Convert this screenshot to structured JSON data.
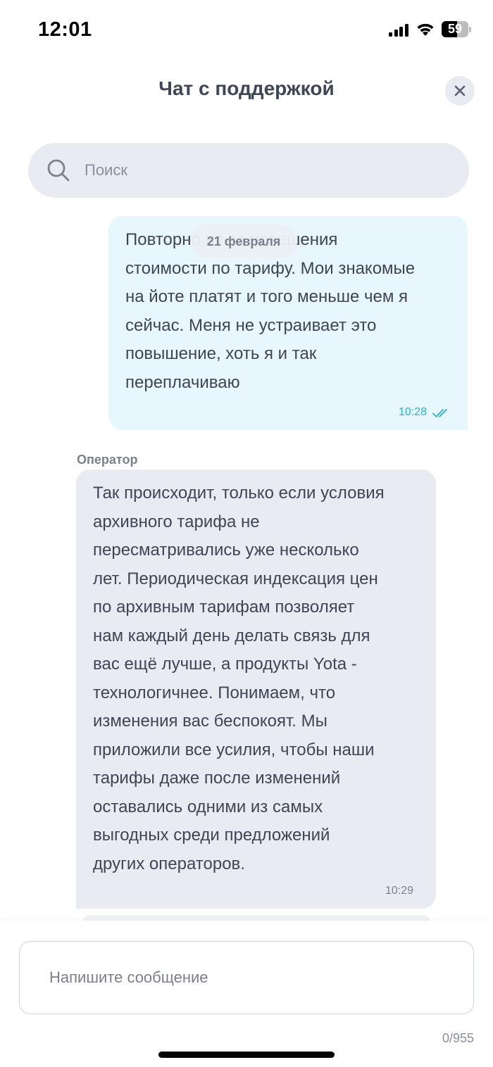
{
  "status_bar": {
    "time": "12:01",
    "battery": "59",
    "battery_level": 0.59,
    "icons": [
      "signal-icon",
      "wifi-icon",
      "battery-icon"
    ]
  },
  "header": {
    "title": "Чат с поддержкой",
    "close_icon": "close-icon"
  },
  "search": {
    "placeholder": "Поиск",
    "icon": "search-icon"
  },
  "chat": {
    "date_badge": "21 февраля",
    "messages": [
      {
        "direction": "outgoing",
        "text": "Повторно из-за повешения\nстоимости по тарифу. Мои знакомые\nна йоте платят и того меньше чем я\nсейчас. Меня не устраивает это\nповышение, хоть я и так\nпереплачиваю",
        "time": "10:28",
        "status_icon": "double-check-icon"
      },
      {
        "direction": "incoming",
        "sender": "Оператор",
        "text": "Так происходит, только если условия\nархивного тарифа не\nпересматривались уже несколько\nлет. Периодическая индексация цен\nпо архивным тарифам позволяет\nнам каждый день делать связь для\nвас ещё лучше, а продукты Yota -\nтехнологичнее. Понимаем, что\nизменения вас беспокоят. Мы\nприложили все усилия, чтобы наши\nтарифы даже после изменений\nоставались одними из самых\nвыгодных среди предложений\nдругих операторов.",
        "time": "10:29"
      }
    ]
  },
  "composer": {
    "placeholder": "Напишите сообщение",
    "counter": "0/955"
  },
  "colors": {
    "outgoing_bubble": "#e8f6fd",
    "incoming_bubble": "#e8ebf2",
    "time_accent": "#2bb0cc"
  }
}
